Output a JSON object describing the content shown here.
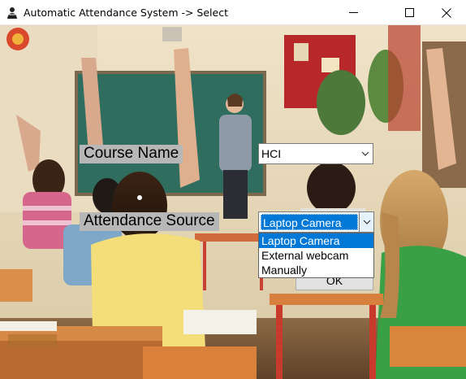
{
  "window": {
    "title": "Automatic Attendance System -> Select",
    "app_icon": "person-icon",
    "controls": {
      "minimize": "minimize-icon",
      "maximize": "maximize-icon",
      "close": "close-icon"
    }
  },
  "form": {
    "course_label": "Course Name",
    "course_value": "HCI",
    "source_label": "Attendance Source",
    "source_value": "Laptop Camera",
    "source_options": [
      "Laptop Camera",
      "External webcam",
      "Manually"
    ],
    "ok_label": "OK"
  },
  "colors": {
    "highlight": "#0078d7",
    "label_bg": "#b7b7b7"
  }
}
